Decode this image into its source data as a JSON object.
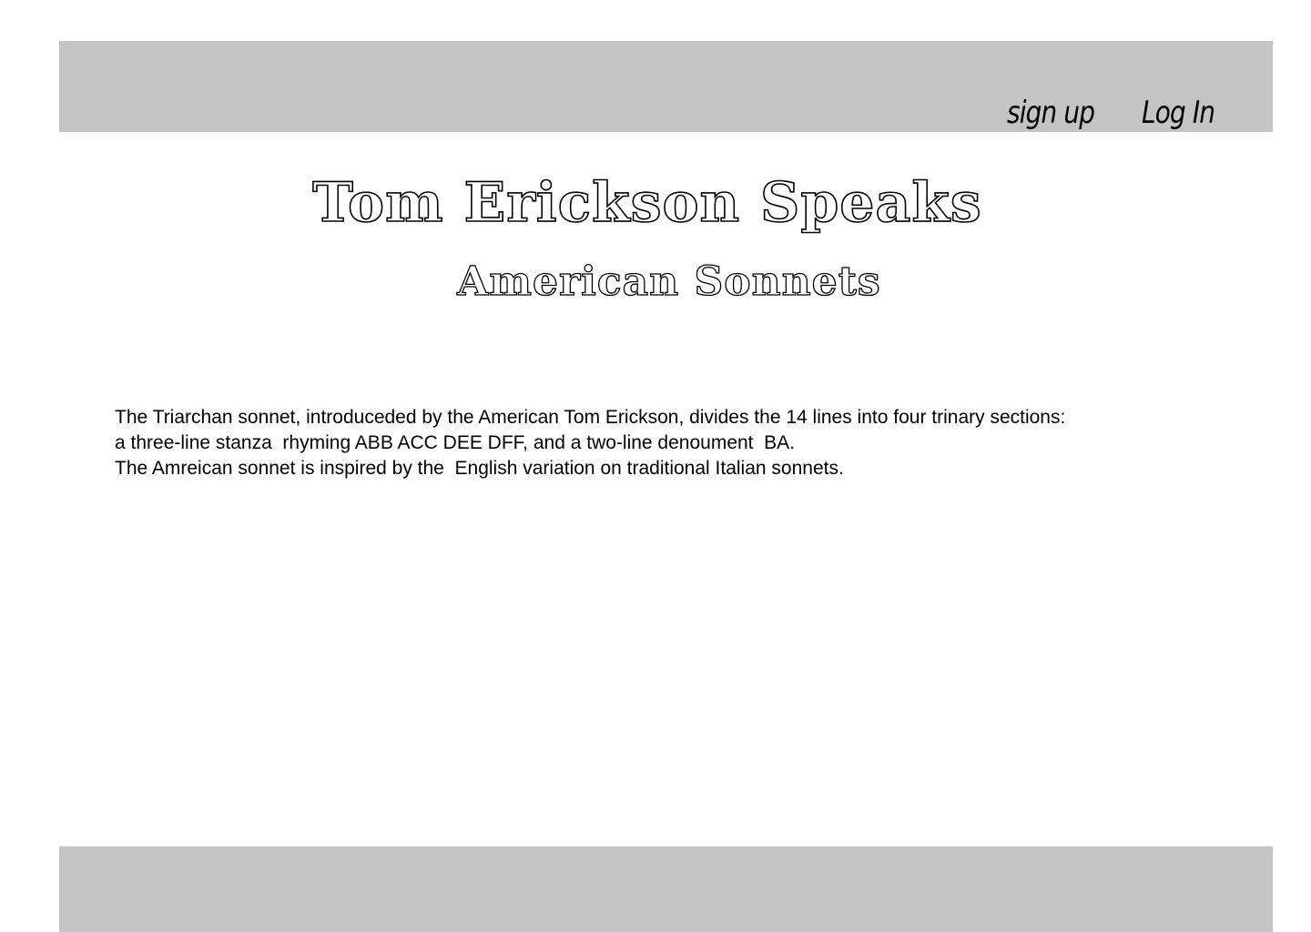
{
  "header": {
    "sign_up_label": "sign up",
    "log_in_label": "Log In"
  },
  "main": {
    "title": "Tom Erickson Speaks",
    "subtitle": "American Sonnets",
    "description_lines": [
      "The Triarchan sonnet, introduceded by the American Tom Erickson, divides the 14 lines into four trinary sections:",
      "a three-line stanza  rhyming ABB ACC DEE DFF, and a two-line denoument  BA.",
      "The Amreican sonnet is inspired by the  English variation on traditional Italian sonnets."
    ]
  },
  "colors": {
    "bar_background": "#c4c4c4",
    "page_background": "#ffffff",
    "text": "#000000"
  }
}
